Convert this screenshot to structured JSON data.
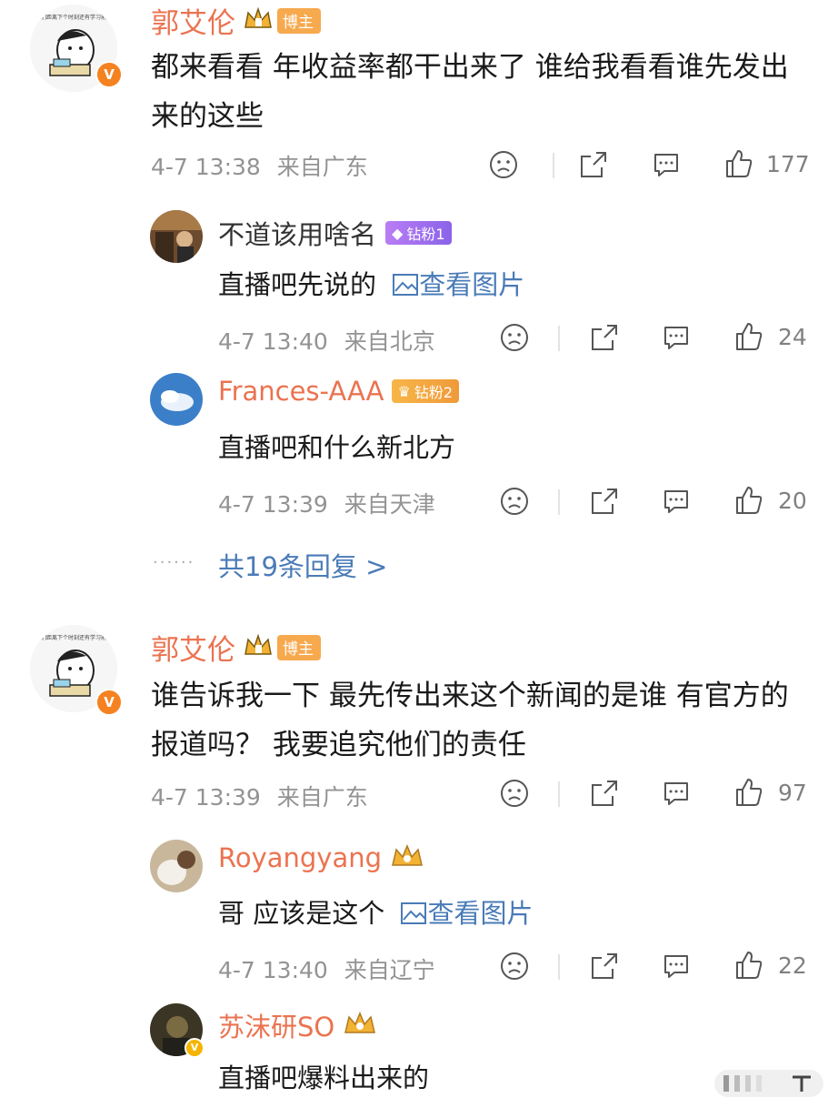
{
  "comments": [
    {
      "author": "郭艾伦",
      "badge": "博主",
      "text": "都来看看 年收益率都干出来了 谁给我看看谁先发出来的这些",
      "time": "4-7 13:38",
      "location": "来自广东",
      "likes": "177",
      "avatar_caption": "我们距离下个时刻还有学习前进",
      "replies": [
        {
          "author": "不道该用啥名",
          "badge": "钻粉1",
          "text": "直播吧先说的",
          "link": "查看图片",
          "time": "4-7 13:40",
          "location": "来自北京",
          "likes": "24"
        },
        {
          "author": "Frances-AAA",
          "badge": "钻粉2",
          "text": "直播吧和什么新北方",
          "time": "4-7 13:39",
          "location": "来自天津",
          "likes": "20"
        }
      ],
      "more_replies": "共19条回复 >"
    },
    {
      "author": "郭艾伦",
      "badge": "博主",
      "text": "谁告诉我一下 最先传出来这个新闻的是谁 有官方的报道吗？ 我要追究他们的责任",
      "time": "4-7 13:39",
      "location": "来自广东",
      "likes": "97",
      "avatar_caption": "我们距离下个时刻还有学习前进",
      "replies": [
        {
          "author": "Royangyang",
          "text": "哥 应该是这个",
          "link": "查看图片",
          "time": "4-7 13:40",
          "location": "来自辽宁",
          "likes": "22"
        },
        {
          "author": "苏沫研SO",
          "text": "直播吧爆料出来的"
        }
      ]
    }
  ],
  "icons": {
    "dislike": "sad-face-icon",
    "share": "share-icon",
    "comment": "comment-icon",
    "like": "thumbs-up-icon",
    "image": "image-icon",
    "verified": "v-icon",
    "crown": "crown-icon",
    "diamond": "diamond-icon"
  },
  "colors": {
    "name": "#eb7350",
    "link": "#4a7bb7",
    "meta": "#939393",
    "blogger_tag": "#f7a94e",
    "diamond_tag": "#8a63e8"
  }
}
